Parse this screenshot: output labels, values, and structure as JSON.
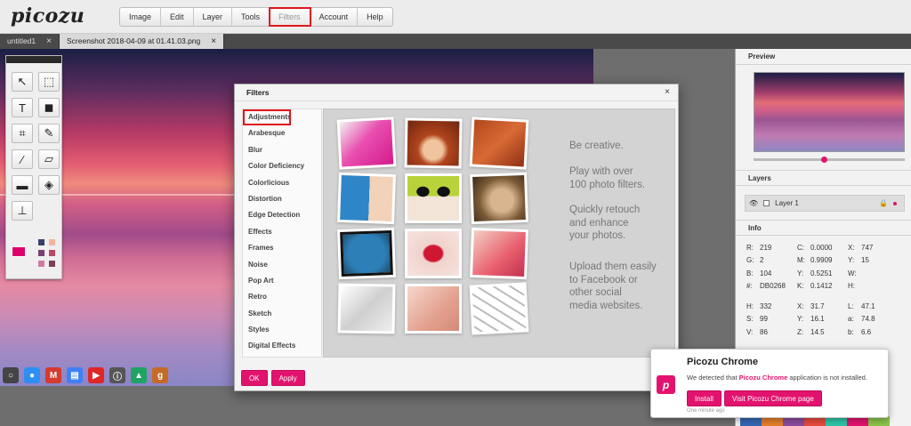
{
  "app": {
    "logo": "picozu"
  },
  "menu": [
    {
      "label": "Image",
      "highlighted": false
    },
    {
      "label": "Edit",
      "highlighted": false
    },
    {
      "label": "Layer",
      "highlighted": false
    },
    {
      "label": "Tools",
      "highlighted": false
    },
    {
      "label": "Filters",
      "highlighted": true
    },
    {
      "label": "Account",
      "highlighted": false
    },
    {
      "label": "Help",
      "highlighted": false
    }
  ],
  "tabs": [
    {
      "label": "untitled1",
      "close": "×",
      "active": false
    },
    {
      "label": "Screenshot 2018-04-09 at 01.41.03.png",
      "close": "×",
      "active": true
    }
  ],
  "toolbox": {
    "tools": [
      {
        "name": "move-tool-icon",
        "glyph": "↖"
      },
      {
        "name": "marquee-select-icon",
        "glyph": "⬚"
      },
      {
        "name": "text-tool-icon",
        "glyph": "T"
      },
      {
        "name": "shape-tool-icon",
        "glyph": "◼"
      },
      {
        "name": "crop-tool-icon",
        "glyph": "⌗"
      },
      {
        "name": "brush-tool-icon",
        "glyph": "✎"
      },
      {
        "name": "eyedropper-icon",
        "glyph": "⁄"
      },
      {
        "name": "eraser-icon",
        "glyph": "▱"
      },
      {
        "name": "ruler-icon",
        "glyph": "▬"
      },
      {
        "name": "fill-bucket-icon",
        "glyph": "◈"
      },
      {
        "name": "stamp-tool-icon",
        "glyph": "⊥"
      }
    ],
    "foreground_color": "#DB0268",
    "background_color": "#000000"
  },
  "taskbar_icons": [
    {
      "name": "circle-app-icon",
      "color": "#444444",
      "glyph": "○"
    },
    {
      "name": "chrome-icon",
      "color": "#2f8ef2",
      "glyph": "●"
    },
    {
      "name": "gmail-icon",
      "color": "#d33c2f",
      "glyph": "M"
    },
    {
      "name": "docs-icon",
      "color": "#3e80f6",
      "glyph": "▤"
    },
    {
      "name": "youtube-icon",
      "color": "#e02727",
      "glyph": "▶"
    },
    {
      "name": "info-app-icon",
      "color": "#555555",
      "glyph": "ⓘ"
    },
    {
      "name": "drive-icon",
      "color": "#1fa463",
      "glyph": "▲"
    },
    {
      "name": "bookmark-app-icon",
      "color": "#c46b28",
      "glyph": "g"
    }
  ],
  "right_panel": {
    "preview_title": "Preview",
    "layers_title": "Layers",
    "layer_name": "Layer 1",
    "info_title": "Info",
    "info_rows_top": [
      [
        "R:",
        "219",
        "C:",
        "0.0000",
        "X:",
        "747"
      ],
      [
        "G:",
        "2",
        "M:",
        "0.9909",
        "Y:",
        "15"
      ],
      [
        "B:",
        "104",
        "Y:",
        "0.5251",
        "W:",
        ""
      ],
      [
        "#:",
        "DB0268",
        "K:",
        "0.1412",
        "H:",
        ""
      ]
    ],
    "info_rows_bottom": [
      [
        "H:",
        "332",
        "X:",
        "31.7",
        "L:",
        "47.1"
      ],
      [
        "S:",
        "99",
        "Y:",
        "16.1",
        "a:",
        "74.8"
      ],
      [
        "V:",
        "86",
        "Z:",
        "14.5",
        "b:",
        "6.6"
      ]
    ]
  },
  "filters_dialog": {
    "title": "Filters",
    "close": "×",
    "items": [
      "Adjustments",
      "Arabesque",
      "Blur",
      "Color Deficiency",
      "Colorlicious",
      "Distortion",
      "Edge Detection",
      "Effects",
      "Frames",
      "Noise",
      "Pop Art",
      "Retro",
      "Sketch",
      "Styles",
      "Digital Effects"
    ],
    "selected": "Adjustments",
    "promo": [
      "Be creative.",
      "Play with over\n100 photo filters.",
      "Quickly retouch\nand enhance\nyour photos.",
      "Upload them easily\nto Facebook or\nother  social\nmedia websites."
    ],
    "ok_label": "OK",
    "apply_label": "Apply"
  },
  "chrome_popup": {
    "title": "Picozu Chrome",
    "message_pre": "We detected that ",
    "message_app": "Picozu Chrome",
    "message_post": " application is not installed.",
    "install_label": "Install",
    "visit_label": "Visit Picozu Chrome page",
    "time": "One minute ago"
  }
}
